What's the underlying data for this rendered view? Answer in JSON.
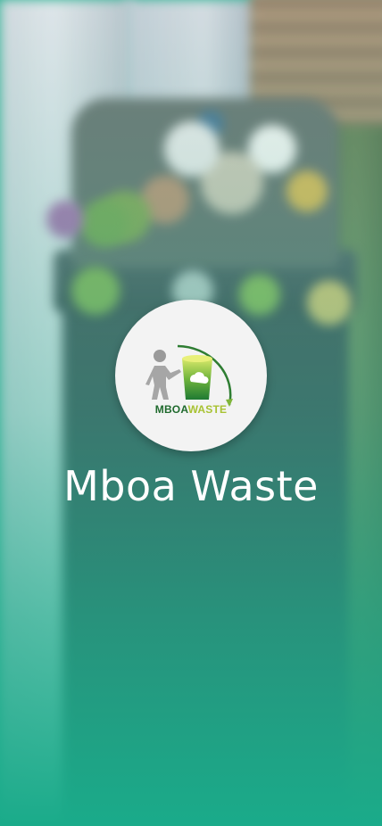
{
  "app": {
    "title": "Mboa Waste",
    "logo_word_primary": "MBOA",
    "logo_word_secondary": "WASTE"
  },
  "colors": {
    "accent": "#1aab8a",
    "logo_dark_green": "#1f6a2d",
    "logo_light_green": "#a8c232",
    "title_text": "#ffffff"
  },
  "background": {
    "description_icon": "trash-bin-photo"
  }
}
